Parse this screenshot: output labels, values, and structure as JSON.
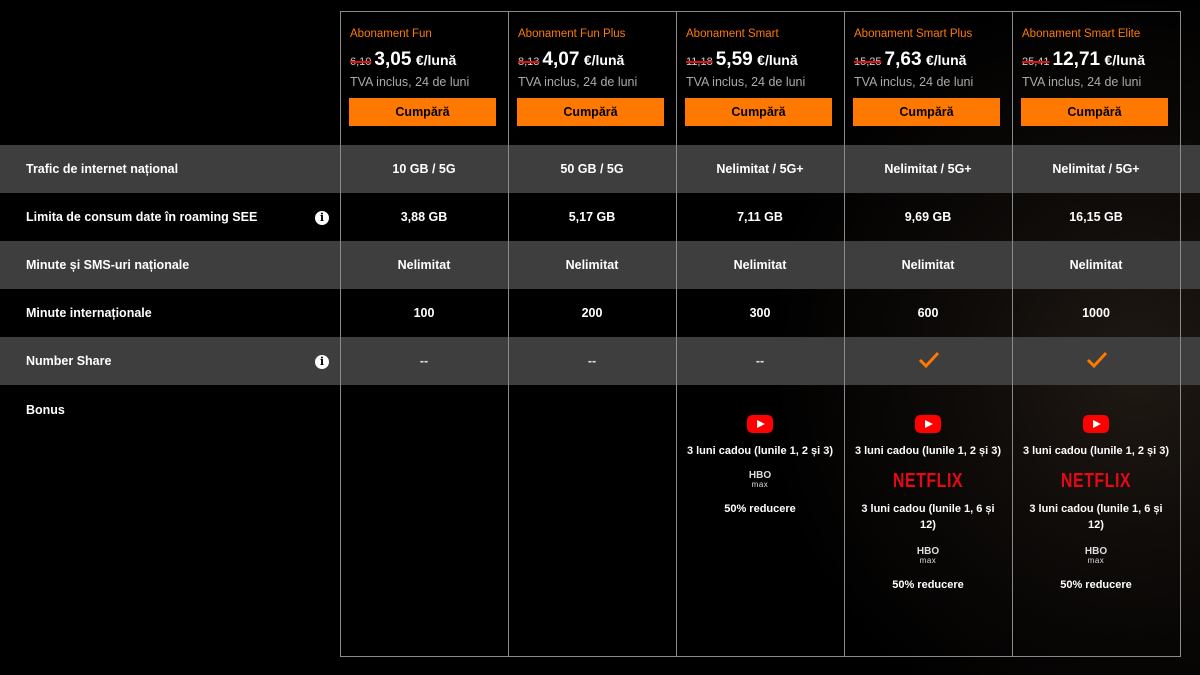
{
  "buy_label": "Cumpără",
  "currency_unit": "€/lună",
  "accent_color": "#ff7900",
  "plans": [
    {
      "name": "Abonament Fun",
      "old_price": "6,10",
      "price": "3,05",
      "tva": "TVA inclus, 24 de luni"
    },
    {
      "name": "Abonament Fun Plus",
      "old_price": "8,13",
      "price": "4,07",
      "tva": "TVA inclus, 24 de luni"
    },
    {
      "name": "Abonament Smart",
      "old_price": "11,18",
      "price": "5,59",
      "tva": "TVA inclus, 24 de luni"
    },
    {
      "name": "Abonament Smart Plus",
      "old_price": "15,25",
      "price": "7,63",
      "tva": "TVA inclus, 24 de luni"
    },
    {
      "name": "Abonament Smart Elite",
      "old_price": "25,41",
      "price": "12,71",
      "tva": "TVA inclus, 24 de luni"
    }
  ],
  "rows": [
    {
      "label": "Trafic de internet național",
      "info": false,
      "values": [
        "10 GB / 5G",
        "50 GB / 5G",
        "Nelimitat / 5G+",
        "Nelimitat / 5G+",
        "Nelimitat / 5G+"
      ]
    },
    {
      "label": "Limita de consum date în roaming SEE",
      "info": true,
      "values": [
        "3,88 GB",
        "5,17 GB",
        "7,11 GB",
        "9,69 GB",
        "16,15 GB"
      ]
    },
    {
      "label": "Minute și SMS-uri naționale",
      "info": false,
      "values": [
        "Nelimitat",
        "Nelimitat",
        "Nelimitat",
        "Nelimitat",
        "Nelimitat"
      ]
    },
    {
      "label": "Minute internaționale",
      "info": false,
      "values": [
        "100",
        "200",
        "300",
        "600",
        "1000"
      ]
    },
    {
      "label": "Number Share",
      "info": true,
      "values": [
        "--",
        "--",
        "--",
        "check-icon",
        "check-icon"
      ]
    }
  ],
  "info_icon_glyph": "i",
  "bonus": {
    "label": "Bonus",
    "youtube_text": "3 luni cadou (lunile 1, 2 și 3)",
    "netflix_logo": "NETFLIX",
    "netflix_text": "3 luni cadou (lunile 1, 6 și 12)",
    "hbo_logo": "HBO",
    "hbo_logo_sub": "max",
    "hbo_text": "50% reducere"
  }
}
